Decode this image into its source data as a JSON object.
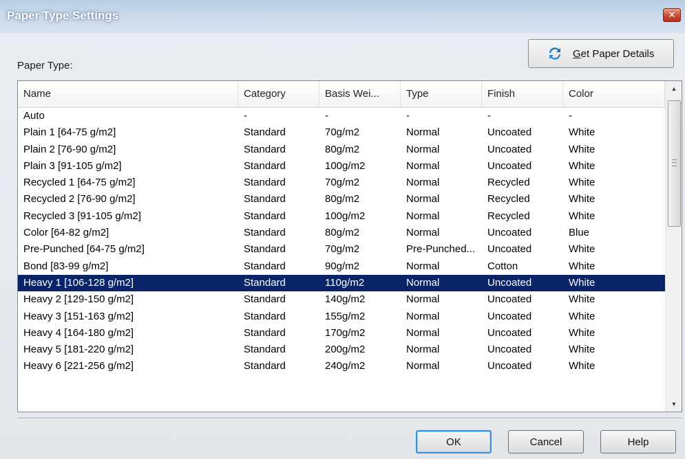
{
  "window": {
    "title": "Paper Type Settings",
    "close_icon": "close-icon"
  },
  "paper_type_label": "Paper Type:",
  "get_details_button": {
    "label": "Get Paper Details",
    "icon": "refresh-icon",
    "icon_color": "#1a6fc4"
  },
  "table": {
    "columns": [
      "Name",
      "Category",
      "Basis Wei...",
      "Type",
      "Finish",
      "Color"
    ],
    "selected_row": 10,
    "selected_color": "#0a246a",
    "rows": [
      [
        "Auto",
        "-",
        "-",
        "-",
        "-",
        "-"
      ],
      [
        "Plain 1 [64-75 g/m2]",
        "Standard",
        "70g/m2",
        "Normal",
        "Uncoated",
        "White"
      ],
      [
        "Plain 2 [76-90 g/m2]",
        "Standard",
        "80g/m2",
        "Normal",
        "Uncoated",
        "White"
      ],
      [
        "Plain 3 [91-105 g/m2]",
        "Standard",
        "100g/m2",
        "Normal",
        "Uncoated",
        "White"
      ],
      [
        "Recycled 1 [64-75 g/m2]",
        "Standard",
        "70g/m2",
        "Normal",
        "Recycled",
        "White"
      ],
      [
        "Recycled 2 [76-90 g/m2]",
        "Standard",
        "80g/m2",
        "Normal",
        "Recycled",
        "White"
      ],
      [
        "Recycled 3 [91-105 g/m2]",
        "Standard",
        "100g/m2",
        "Normal",
        "Recycled",
        "White"
      ],
      [
        "Color [64-82 g/m2]",
        "Standard",
        "80g/m2",
        "Normal",
        "Uncoated",
        "Blue"
      ],
      [
        "Pre-Punched [64-75 g/m2]",
        "Standard",
        "70g/m2",
        "Pre-Punched...",
        "Uncoated",
        "White"
      ],
      [
        "Bond [83-99 g/m2]",
        "Standard",
        "90g/m2",
        "Normal",
        "Cotton",
        "White"
      ],
      [
        "Heavy 1 [106-128 g/m2]",
        "Standard",
        "110g/m2",
        "Normal",
        "Uncoated",
        "White"
      ],
      [
        "Heavy 2 [129-150 g/m2]",
        "Standard",
        "140g/m2",
        "Normal",
        "Uncoated",
        "White"
      ],
      [
        "Heavy 3 [151-163 g/m2]",
        "Standard",
        "155g/m2",
        "Normal",
        "Uncoated",
        "White"
      ],
      [
        "Heavy 4 [164-180 g/m2]",
        "Standard",
        "170g/m2",
        "Normal",
        "Uncoated",
        "White"
      ],
      [
        "Heavy 5 [181-220 g/m2]",
        "Standard",
        "200g/m2",
        "Normal",
        "Uncoated",
        "White"
      ],
      [
        "Heavy 6 [221-256 g/m2]",
        "Standard",
        "240g/m2",
        "Normal",
        "Uncoated",
        "White"
      ]
    ]
  },
  "buttons": {
    "ok": "OK",
    "cancel": "Cancel",
    "help": "Help"
  }
}
